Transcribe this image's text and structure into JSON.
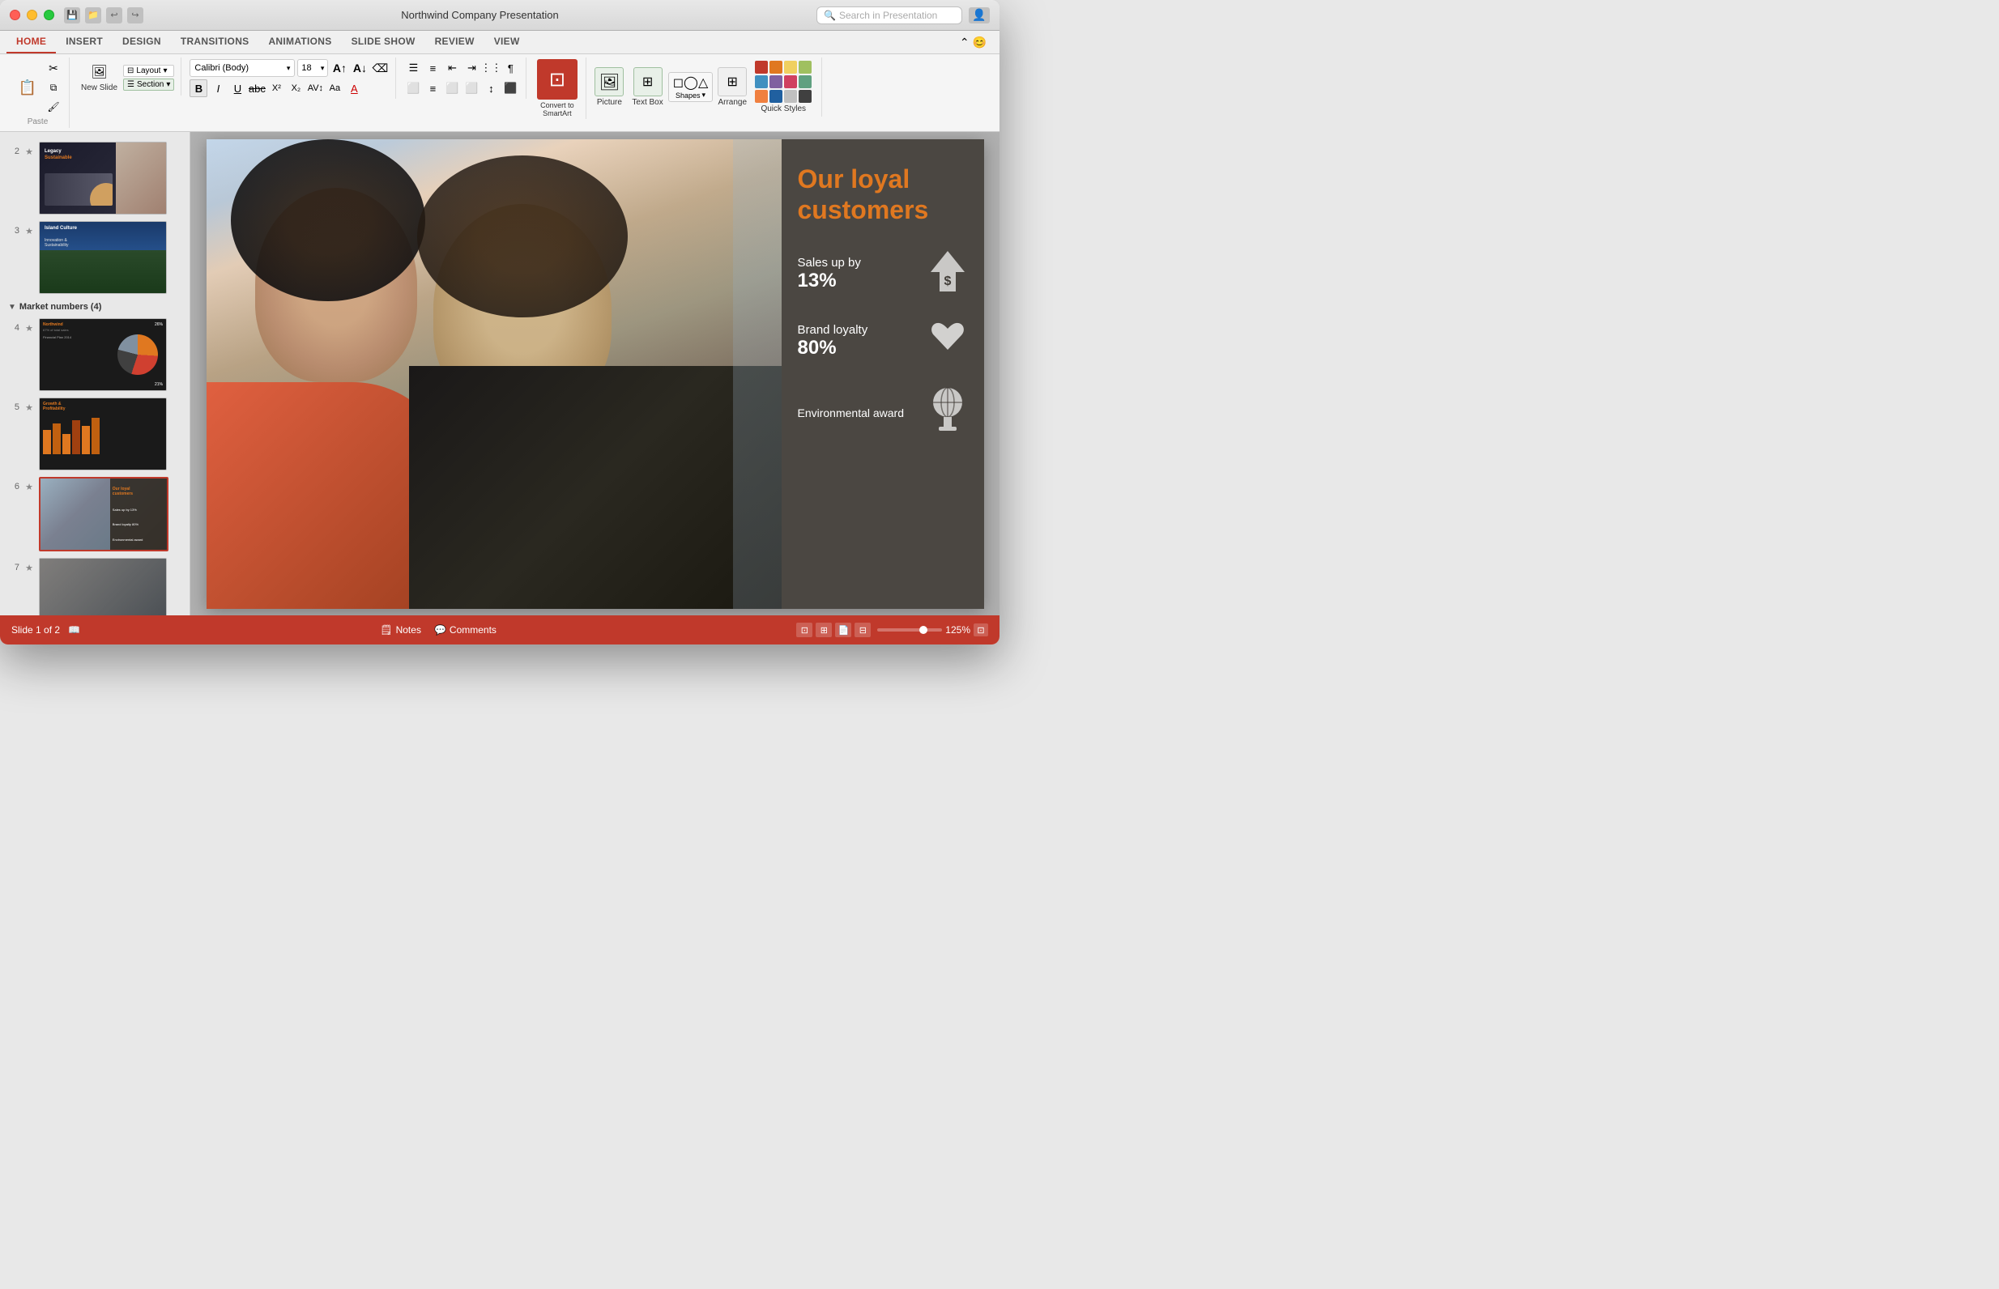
{
  "window": {
    "title": "Northwind Company Presentation"
  },
  "titlebar": {
    "search_placeholder": "Search in Presentation",
    "icons": [
      "save",
      "open-folder",
      "undo",
      "redo"
    ]
  },
  "ribbon": {
    "tabs": [
      "HOME",
      "INSERT",
      "DESIGN",
      "TRANSITIONS",
      "ANIMATIONS",
      "SLIDE SHOW",
      "REVIEW",
      "VIEW"
    ],
    "active_tab": "HOME",
    "groups": {
      "clipboard": {
        "label": "Paste",
        "new_slide_label": "New Slide"
      },
      "slides": {
        "layout_label": "Layout",
        "section_label": "Section"
      },
      "font": {
        "font_name": "Calibri (Body)",
        "font_size": "18"
      },
      "formatting": {
        "bold": "B",
        "italic": "I",
        "underline": "U",
        "strikethrough": "ab̶c̶"
      },
      "insert": {
        "picture_label": "Picture",
        "textbox_label": "Text Box",
        "shapes_label": "Shapes",
        "arrange_label": "Arrange",
        "quick_styles_label": "Quick Styles",
        "convert_label": "Convert to SmartArt"
      }
    }
  },
  "slides": {
    "items": [
      {
        "num": "2",
        "starred": true,
        "type": "dark"
      },
      {
        "num": "3",
        "starred": true,
        "type": "solar"
      },
      {
        "num": "4",
        "starred": true,
        "type": "chart"
      },
      {
        "num": "5",
        "starred": true,
        "type": "bars"
      },
      {
        "num": "6",
        "starred": true,
        "type": "customers",
        "active": true
      },
      {
        "num": "7",
        "starred": true,
        "type": "family"
      }
    ],
    "section_name": "Market numbers (4)"
  },
  "current_slide": {
    "title": "Our loyal customers",
    "stats": [
      {
        "label": "Sales up by",
        "value": "13%",
        "icon": "↑$"
      },
      {
        "label": "Brand loyalty",
        "value": "80%",
        "icon": "♥"
      },
      {
        "label": "Environmental award",
        "value": "",
        "icon": "🌐"
      }
    ]
  },
  "statusbar": {
    "slide_info": "Slide 1 of 2",
    "notes_label": "Notes",
    "comments_label": "Comments",
    "zoom_level": "125%"
  }
}
